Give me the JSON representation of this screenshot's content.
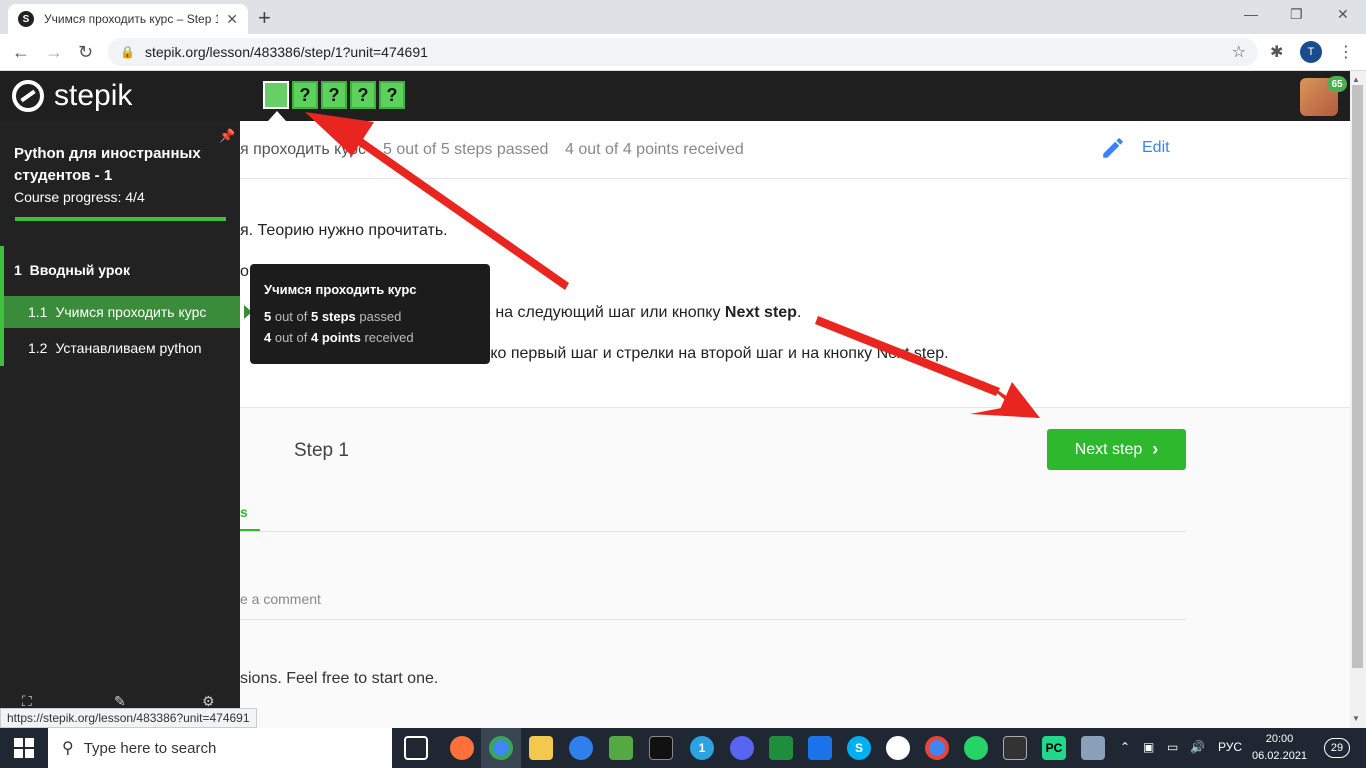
{
  "browser": {
    "tab_title": "Учимся проходить курс – Step 1",
    "tab_favicon": "stepik-icon",
    "url": "stepik.org/lesson/483386/step/1?unit=474691",
    "profile_initial": "T"
  },
  "header": {
    "logo_text": "stepik",
    "steps": [
      {
        "label": "",
        "state": "passed-active"
      },
      {
        "label": "?",
        "state": "passed"
      },
      {
        "label": "?",
        "state": "passed"
      },
      {
        "label": "?",
        "state": "passed"
      },
      {
        "label": "?",
        "state": "passed"
      }
    ],
    "avatar_badge": "65"
  },
  "lesson_bar": {
    "crumb": "я проходить курс",
    "steps_stat": "5 out of 5 steps passed",
    "points_stat": "4 out of 4 points  received",
    "edit_label": "Edit"
  },
  "content": {
    "line1": "я. Теорию нужно прочитать.",
    "line2": "он",
    "line3_pre": "е на следующий шаг или кнопку ",
    "line3_bold": "Next step",
    "line3_post": ".",
    "line4": "ько первый шаг и стрелки на второй шаг и на кнопку Next step."
  },
  "step_section": {
    "title": "Step 1",
    "next_label": "Next step",
    "tab_fragment": "s",
    "comment_placeholder": "e a comment",
    "discussions_text": "sions. Feel free to start one."
  },
  "sidebar": {
    "course_title": "Python для иностранных студентов - 1",
    "progress_label": "Course progress:  4/4",
    "progress_fraction": 1.0,
    "module": {
      "number": "1",
      "title": "Вводный урок"
    },
    "lessons": [
      {
        "number": "1.1",
        "title": "Учимся проходить курс",
        "active": true
      },
      {
        "number": "1.2",
        "title": "Устанавливаем python",
        "active": false
      }
    ]
  },
  "tooltip": {
    "title": "Учимся проходить курс",
    "steps_num": "5",
    "steps_mid": " out of ",
    "steps_total": "5 steps",
    "steps_suffix": " passed",
    "points_num": "4",
    "points_mid": " out of ",
    "points_total": "4 points",
    "points_suffix": " received"
  },
  "status_url": "https://stepik.org/lesson/483386?unit=474691",
  "taskbar": {
    "search_placeholder": "Type here to search",
    "language": "РУС",
    "time": "20:00",
    "date": "06.02.2021",
    "notifications": "29",
    "telegram_badge": "1"
  },
  "colors": {
    "accent_green": "#2eb82e",
    "edit_blue": "#3b82f6",
    "arrow_red": "#e8251f",
    "header_dark": "#1f1f1f"
  }
}
